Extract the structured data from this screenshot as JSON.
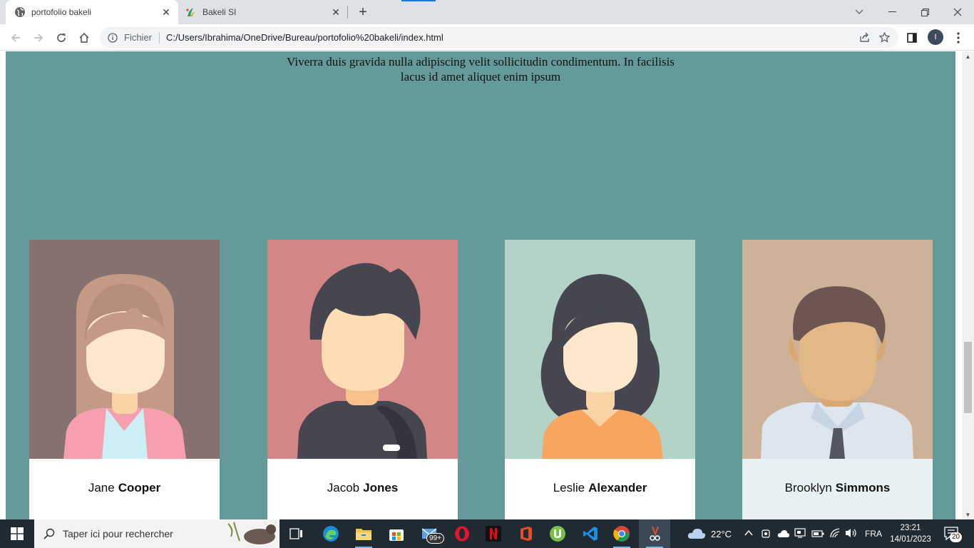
{
  "browser": {
    "tabs": [
      {
        "title": "portofolio bakeli",
        "active": true
      },
      {
        "title": "Bakeli SI",
        "active": false
      }
    ],
    "new_tab": "+",
    "close_glyph": "✕",
    "address": {
      "security_label": "Fichier",
      "url": "C:/Users/Ibrahima/OneDrive/Bureau/portofolio%20bakeli/index.html"
    },
    "profile_initial": "I"
  },
  "page": {
    "intro_line1": "Viverra duis gravida nulla adipiscing velit sollicitudin condimentum. In facilisis",
    "intro_line2": "lacus id amet aliquet enim ipsum",
    "team": [
      {
        "first": "Jane",
        "last": "Cooper",
        "bg": "#847170"
      },
      {
        "first": "Jacob",
        "last": "Jones",
        "bg": "#d38686"
      },
      {
        "first": "Leslie",
        "last": "Alexander",
        "bg": "#b3d3c6"
      },
      {
        "first": "Brooklyn",
        "last": "Simmons",
        "bg": "#cdb299"
      }
    ]
  },
  "taskbar": {
    "search_placeholder": "Taper ici pour rechercher",
    "mail_badge": "99+",
    "weather": "22°C",
    "language": "FRA",
    "time": "23:21",
    "date": "14/01/2023",
    "notification_count": "20"
  }
}
